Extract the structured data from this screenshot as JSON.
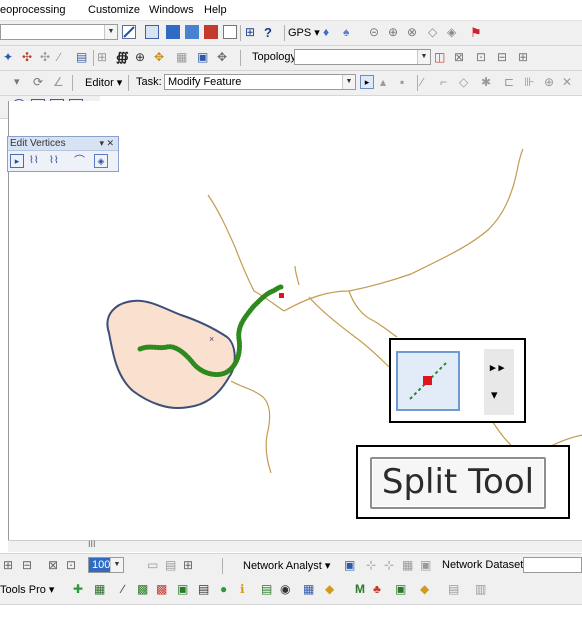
{
  "menu": [
    "eoprocessing",
    "Customize",
    "Windows",
    "Help"
  ],
  "toolbar2": {
    "topology_label": "Topology:"
  },
  "toolbar3": {
    "editor_label": "Editor ▾",
    "task_label": "Task:",
    "task_value": "Modify Feature"
  },
  "edit_vertices": {
    "title": "Edit Vertices"
  },
  "tools": {
    "gps_label": "GPS ▾"
  },
  "split_tool": {
    "label": "Split Tool"
  },
  "scroll": {
    "mark": "III"
  },
  "bottom1": {
    "zoom_value": "100%",
    "network_analyst": "Network Analyst ▾",
    "network_dataset": "Network Dataset:"
  },
  "bottom2": {
    "tools_pro": "Tools Pro ▾"
  },
  "colors": {
    "polygon_fill": "#f9e0cf",
    "polygon_stroke": "#3d4f78",
    "river": "#c49b50",
    "split_line": "#2e8a1f",
    "split_point": "#e0141e"
  }
}
